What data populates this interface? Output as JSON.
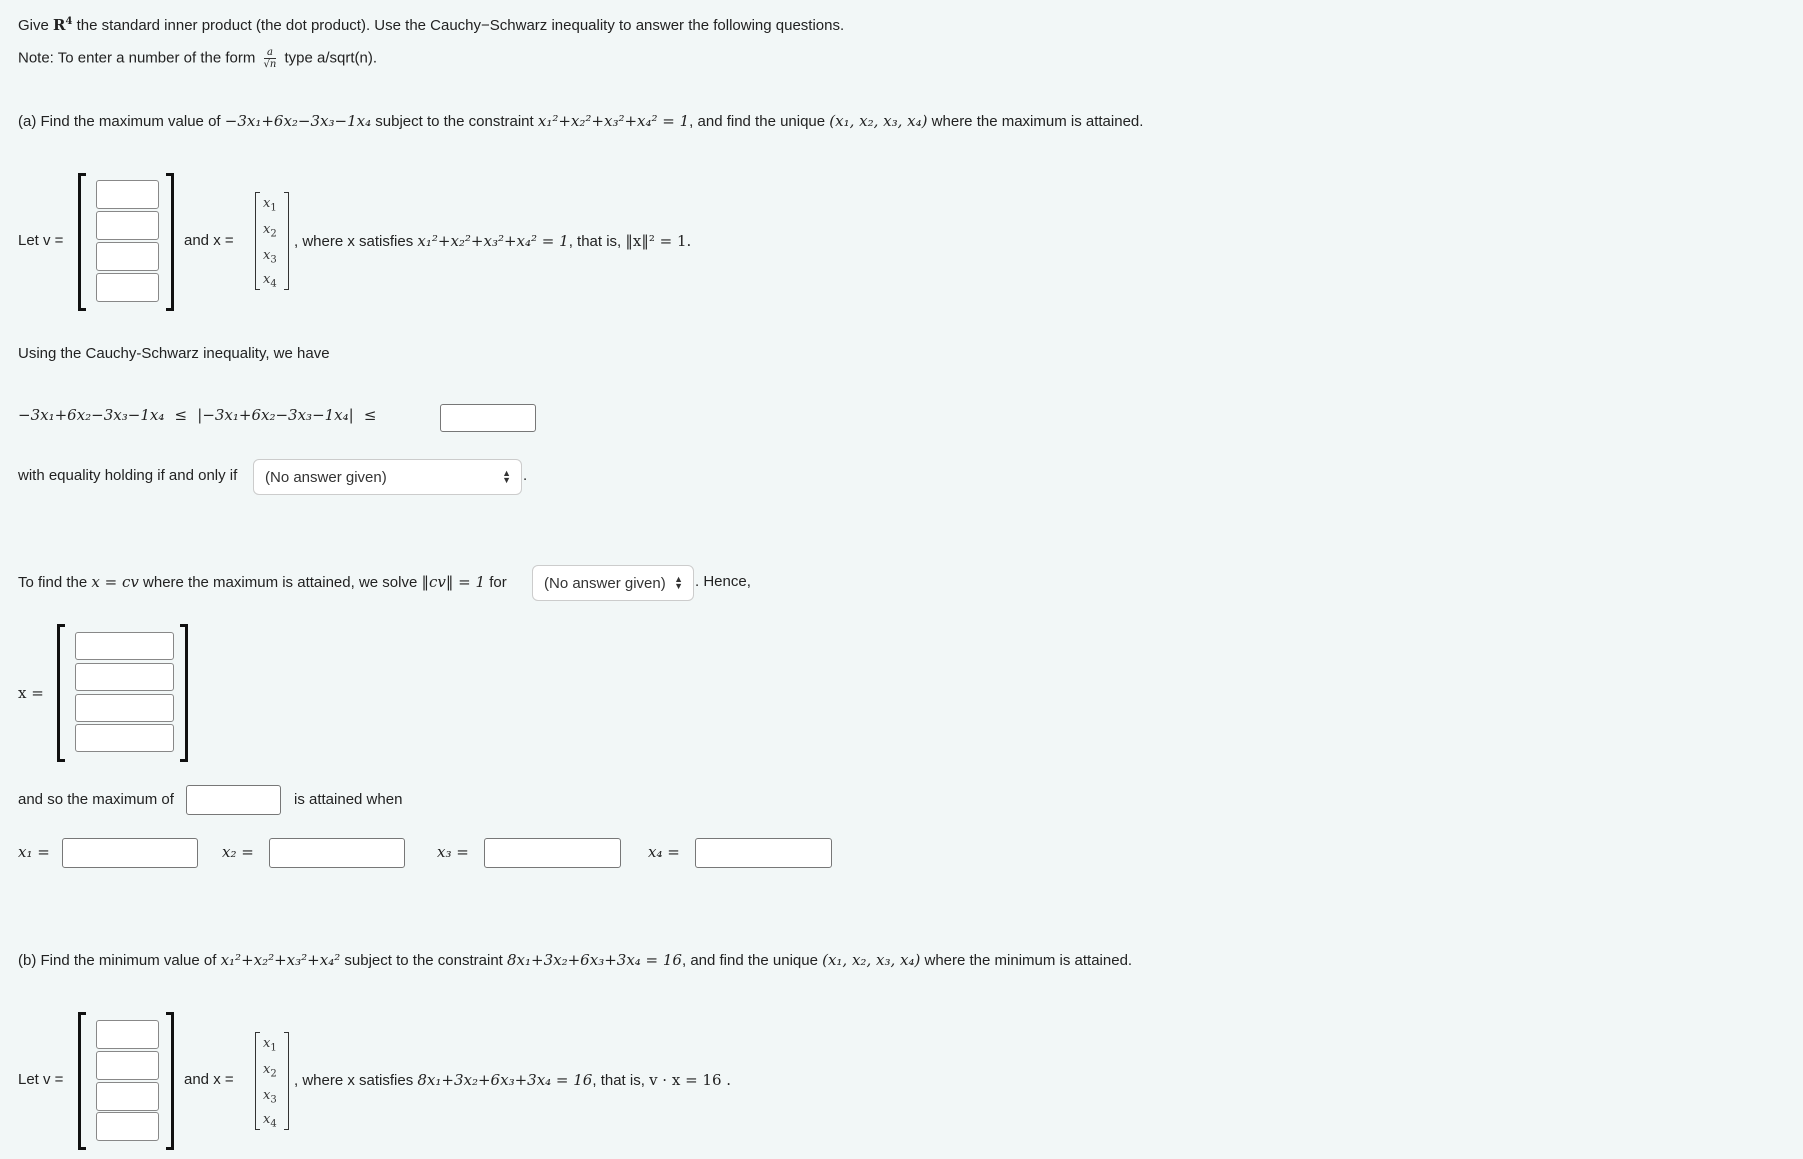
{
  "intro": {
    "give": "Give",
    "space": "R",
    "space_exp": "4",
    "rest": "the standard inner product (the dot product). Use the Cauchy−Schwarz inequality to answer the following questions.",
    "note_label": "Note: To enter a number of the form",
    "note_frac_num": "a",
    "note_frac_den": "√n",
    "note_rest": "type  a/sqrt(n)."
  },
  "part_a": {
    "prompt_start": "(a) Find the maximum value of",
    "objective": "−3x₁+6x₂−3x₃−1x₄",
    "objective_terms": [
      {
        "coef": "−3",
        "var": "x",
        "sub": "1"
      },
      {
        "coef": "+6",
        "var": "x",
        "sub": "2"
      },
      {
        "coef": "−3",
        "var": "x",
        "sub": "3"
      },
      {
        "coef": "−1",
        "var": "x",
        "sub": "4"
      }
    ],
    "prompt_mid": "subject to the constraint",
    "constraint": "x₁²+x₂²+x₃²+x₄² = 1",
    "prompt_mid2": ", and find the unique",
    "tuple": "(x₁, x₂, x₃, x₄)",
    "prompt_end": "where the maximum is attained.",
    "let_v": "Let v =",
    "and_x": "and x =",
    "x_entries": [
      "x",
      "x",
      "x",
      "x"
    ],
    "x_subs": [
      "1",
      "2",
      "3",
      "4"
    ],
    "where_text": ", where x satisfies",
    "where_eq": "x₁²+x₂²+x₃²+x₄² = 1",
    "that_is": ", that is,",
    "norm_eq": "‖x‖² = 1.",
    "using_cs": "Using the Cauchy-Schwarz inequality, we have",
    "ineq_lhs": "−3x₁+6x₂−3x₃−1x₄",
    "le": "≤",
    "ineq_abs": "|−3x₁+6x₂−3x₃−1x₄|",
    "equality_label": "with equality holding if and only if",
    "equality_select": "(No answer given)",
    "to_find_1": "To find the",
    "to_find_eq": "x = cv",
    "to_find_2": "where the maximum is attained, we solve",
    "solve_eq": "‖cv‖ = 1",
    "for_label": "for",
    "for_select": "(No answer given)",
    "hence": ". Hence,",
    "x_eq": "x =",
    "and_so": "and so the maximum of",
    "attained_when": "is attained when",
    "component_labels": [
      "x₁ =",
      "x₂ =",
      "x₃ =",
      "x₄ ="
    ],
    "component_values": [
      "",
      "",
      "",
      ""
    ],
    "v_values": [
      "",
      "",
      "",
      ""
    ],
    "x_values": [
      "",
      "",
      "",
      ""
    ],
    "bound_value": "",
    "max_value": ""
  },
  "part_b": {
    "prompt_start": "(b) Find the minimum value of",
    "objective": "x₁²+x₂²+x₃²+x₄²",
    "prompt_mid": "subject to the constraint",
    "constraint": "8x₁+3x₂+6x₃+3x₄ = 16",
    "prompt_mid2": ", and find the unique",
    "tuple": "(x₁, x₂, x₃, x₄)",
    "prompt_end": "where the minimum is attained.",
    "let_v": "Let v =",
    "and_x": "and x =",
    "where_text": ", where x satisfies",
    "where_eq": "8x₁+3x₂+6x₃+3x₄ = 16",
    "that_is": ", that is,",
    "dot_eq": "v · x = 16 .",
    "v_values": [
      "",
      "",
      "",
      ""
    ]
  }
}
